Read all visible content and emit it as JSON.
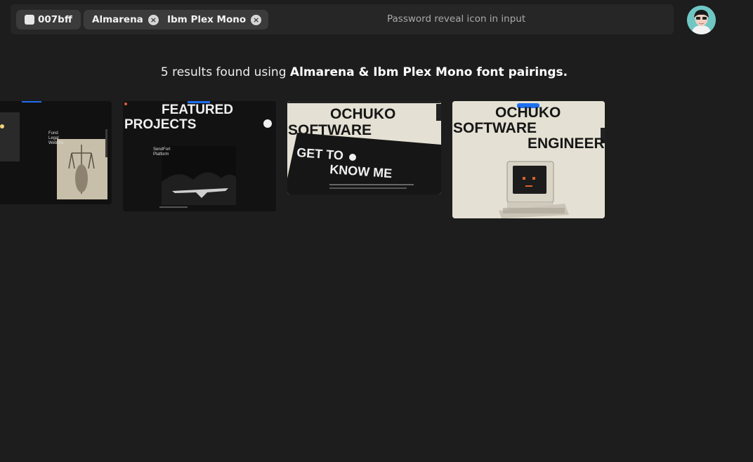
{
  "search": {
    "chips": [
      {
        "label": "007bff",
        "color": "#e6e6e6"
      },
      {
        "label": "Almarena",
        "remove": "×"
      },
      {
        "label": "Ibm Plex Mono",
        "remove": "×"
      }
    ],
    "placeholder": "Password reveal icon in input"
  },
  "results": {
    "count_text": "5 results found using ",
    "fonts_text": "Almarena & Ibm Plex Mono font pairings."
  },
  "cards": [
    {
      "caption": "Fund Legal Website"
    },
    {
      "heading_line1": "FEATURED",
      "heading_line2": "PROJECTS",
      "caption": "SendFort Platform"
    },
    {
      "line1": "OCHUKO",
      "line2": "SOFTWARE",
      "line3": "GET TO",
      "line4": "KNOW ME"
    },
    {
      "line1": "OCHUKO",
      "line2": "SOFTWARE",
      "line3": "ENGINEER"
    }
  ],
  "colors": {
    "background": "#1d1d1d",
    "bar": "#262626",
    "chip": "#3b3b3b",
    "accent": "#1e6ff0"
  }
}
